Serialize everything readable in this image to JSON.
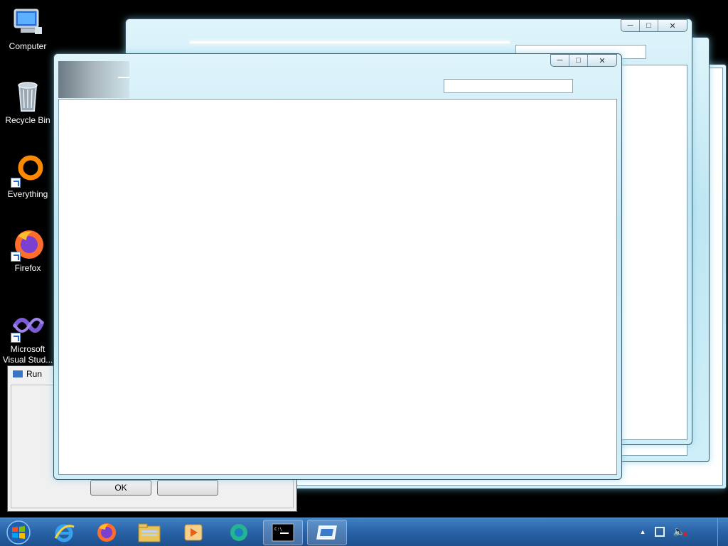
{
  "desktop": {
    "icons": [
      {
        "label": "Computer"
      },
      {
        "label": "Recycle Bin"
      },
      {
        "label": "Everything"
      },
      {
        "label": "Firefox"
      },
      {
        "label": "Microsoft Visual Stud..."
      }
    ]
  },
  "run_dialog": {
    "title": "Run",
    "ok_label": "OK"
  },
  "taskbar": {
    "items": [
      "start-orb",
      "internet-explorer",
      "firefox",
      "file-explorer",
      "media-player",
      "windows-live",
      "command-prompt",
      "window-app"
    ]
  },
  "colors": {
    "taskbar": "#2a65a8",
    "aero_frame": "#cfeff8",
    "desktop": "#000000"
  }
}
